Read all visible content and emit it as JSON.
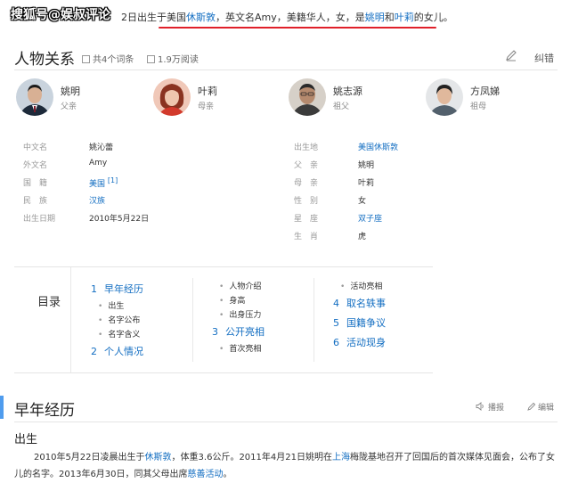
{
  "watermark": "搜狐号@娱叔评论",
  "top_sentence": {
    "prefix": "2日出生于美国",
    "link_houston": "休斯敦",
    "mid1": "，英文名Amy，美籍华人，女，是",
    "link_yaoming": "姚明",
    "and": "和",
    "link_yeli": "叶莉",
    "suffix": "的女儿。"
  },
  "relations": {
    "title": "人物关系",
    "entries_count": "共4个词条",
    "views": "1.9万阅读",
    "error_label": "纠错",
    "people": [
      {
        "name": "姚明",
        "relation": "父亲"
      },
      {
        "name": "叶莉",
        "relation": "母亲"
      },
      {
        "name": "姚志源",
        "relation": "祖父"
      },
      {
        "name": "方凤娣",
        "relation": "祖母"
      }
    ]
  },
  "info": {
    "left": [
      {
        "key": "中文名",
        "value": "姚沁蕾"
      },
      {
        "key": "外文名",
        "value": "Amy"
      },
      {
        "key": "国　籍",
        "value": "美国",
        "sup": "[1]"
      },
      {
        "key": "民　族",
        "value": "汉族"
      },
      {
        "key": "出生日期",
        "value": "2010年5月22日"
      }
    ],
    "right": [
      {
        "key": "出生地",
        "value": "美国休斯敦"
      },
      {
        "key": "父　亲",
        "value": "姚明"
      },
      {
        "key": "母　亲",
        "value": "叶莉"
      },
      {
        "key": "性　别",
        "value": "女"
      },
      {
        "key": "星　座",
        "value": "双子座"
      },
      {
        "key": "生　肖",
        "value": "虎"
      }
    ]
  },
  "toc": {
    "title": "目录",
    "h1": {
      "num": "1",
      "label": "早年经历"
    },
    "h1_subs": [
      "出生",
      "名字公布",
      "名字含义"
    ],
    "h2": {
      "num": "2",
      "label": "个人情况"
    },
    "col2_subs": [
      "人物介绍",
      "身高",
      "出身压力"
    ],
    "h3": {
      "num": "3",
      "label": "公开亮相"
    },
    "h3_subs": [
      "首次亮相"
    ],
    "col3_top_sub": "活动亮相",
    "h4": {
      "num": "4",
      "label": "取名轶事"
    },
    "h5": {
      "num": "5",
      "label": "国籍争议"
    },
    "h6": {
      "num": "6",
      "label": "活动现身"
    }
  },
  "section": {
    "title": "早年经历",
    "tool_play": "播报",
    "tool_edit": "编辑",
    "subtitle": "出生",
    "para": {
      "t1": "2010年5月22日凌晨出生于",
      "l1": "休斯敦",
      "t2": "，体重3.6公斤。2011年4月21日姚明在",
      "l2": "上海",
      "t3": "梅陇基地召开了回国后的首次媒体见面会，公布了女儿的名字。2013年6月30日，同其父母出席",
      "l3": "慈善活动",
      "t4": "。"
    }
  }
}
